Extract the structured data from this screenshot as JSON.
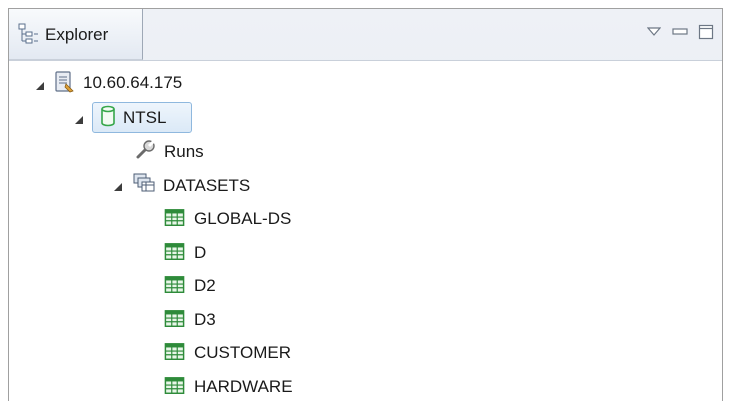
{
  "view": {
    "tab_title": "Explorer",
    "controls": [
      "view-menu",
      "minimize",
      "maximize"
    ]
  },
  "tree": {
    "server": {
      "label": "10.60.64.175",
      "expanded": true
    },
    "database": {
      "label": "NTSL",
      "expanded": true,
      "selected": true
    },
    "runs": {
      "label": "Runs"
    },
    "datasets": {
      "label": "DATASETS",
      "expanded": true,
      "items": [
        "GLOBAL-DS",
        "D",
        "D2",
        "D3",
        "CUSTOMER",
        "HARDWARE"
      ]
    }
  },
  "colors": {
    "selection_border": "#8fb8de",
    "table_icon": "#2e8b3a",
    "db_icon": "#36a64a"
  }
}
